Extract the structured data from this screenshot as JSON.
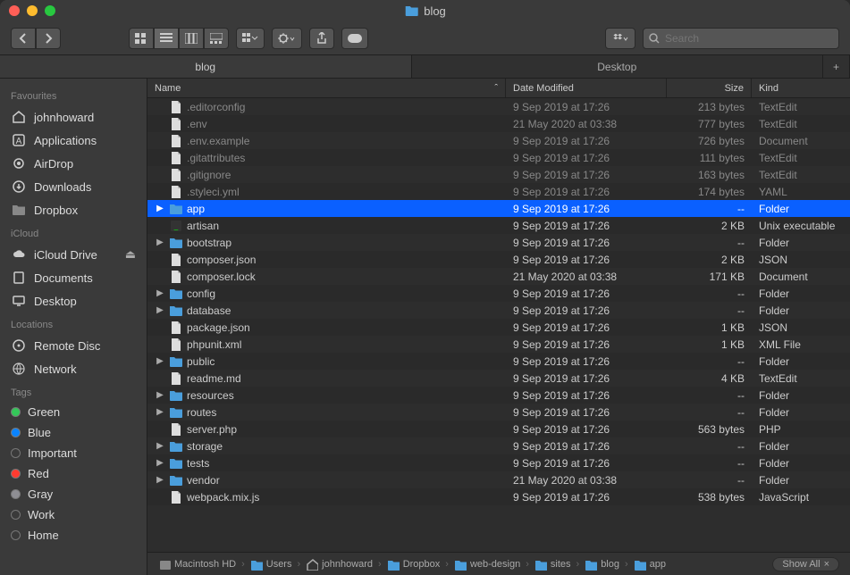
{
  "window": {
    "title": "blog"
  },
  "tabs": [
    {
      "label": "blog",
      "active": true
    },
    {
      "label": "Desktop",
      "active": false
    }
  ],
  "search": {
    "placeholder": "Search"
  },
  "sidebar": {
    "sections": [
      {
        "heading": "Favourites",
        "items": [
          {
            "icon": "home",
            "label": "johnhoward"
          },
          {
            "icon": "app",
            "label": "Applications"
          },
          {
            "icon": "airdrop",
            "label": "AirDrop"
          },
          {
            "icon": "downloads",
            "label": "Downloads"
          },
          {
            "icon": "folder",
            "label": "Dropbox"
          }
        ]
      },
      {
        "heading": "iCloud",
        "items": [
          {
            "icon": "cloud",
            "label": "iCloud Drive",
            "eject": true
          },
          {
            "icon": "doc",
            "label": "Documents"
          },
          {
            "icon": "desktop",
            "label": "Desktop"
          }
        ]
      },
      {
        "heading": "Locations",
        "items": [
          {
            "icon": "disc",
            "label": "Remote Disc"
          },
          {
            "icon": "globe",
            "label": "Network"
          }
        ]
      },
      {
        "heading": "Tags",
        "items": [
          {
            "icon": "tag",
            "color": "#34c759",
            "label": "Green"
          },
          {
            "icon": "tag",
            "color": "#0a84ff",
            "label": "Blue"
          },
          {
            "icon": "tag",
            "color": "",
            "label": "Important"
          },
          {
            "icon": "tag",
            "color": "#ff3b30",
            "label": "Red"
          },
          {
            "icon": "tag",
            "color": "#8e8e93",
            "label": "Gray"
          },
          {
            "icon": "tag",
            "color": "",
            "label": "Work"
          },
          {
            "icon": "tag",
            "color": "",
            "label": "Home"
          }
        ]
      }
    ]
  },
  "columns": {
    "name": "Name",
    "date": "Date Modified",
    "size": "Size",
    "kind": "Kind"
  },
  "files": [
    {
      "exp": "",
      "type": "file",
      "name": ".editorconfig",
      "date": "9 Sep 2019 at 17:26",
      "size": "213 bytes",
      "kind": "TextEdit",
      "dim": true
    },
    {
      "exp": "",
      "type": "file",
      "name": ".env",
      "date": "21 May 2020 at 03:38",
      "size": "777 bytes",
      "kind": "TextEdit",
      "dim": true
    },
    {
      "exp": "",
      "type": "file",
      "name": ".env.example",
      "date": "9 Sep 2019 at 17:26",
      "size": "726 bytes",
      "kind": "Document",
      "dim": true
    },
    {
      "exp": "",
      "type": "file",
      "name": ".gitattributes",
      "date": "9 Sep 2019 at 17:26",
      "size": "111 bytes",
      "kind": "TextEdit",
      "dim": true
    },
    {
      "exp": "",
      "type": "file",
      "name": ".gitignore",
      "date": "9 Sep 2019 at 17:26",
      "size": "163 bytes",
      "kind": "TextEdit",
      "dim": true
    },
    {
      "exp": "",
      "type": "file",
      "name": ".styleci.yml",
      "date": "9 Sep 2019 at 17:26",
      "size": "174 bytes",
      "kind": "YAML",
      "dim": true
    },
    {
      "exp": "▶",
      "type": "folder",
      "name": "app",
      "date": "9 Sep 2019 at 17:26",
      "size": "--",
      "kind": "Folder",
      "selected": true
    },
    {
      "exp": "",
      "type": "exec",
      "name": "artisan",
      "date": "9 Sep 2019 at 17:26",
      "size": "2 KB",
      "kind": "Unix executable"
    },
    {
      "exp": "▶",
      "type": "folder",
      "name": "bootstrap",
      "date": "9 Sep 2019 at 17:26",
      "size": "--",
      "kind": "Folder"
    },
    {
      "exp": "",
      "type": "file",
      "name": "composer.json",
      "date": "9 Sep 2019 at 17:26",
      "size": "2 KB",
      "kind": "JSON"
    },
    {
      "exp": "",
      "type": "file",
      "name": "composer.lock",
      "date": "21 May 2020 at 03:38",
      "size": "171 KB",
      "kind": "Document"
    },
    {
      "exp": "▶",
      "type": "folder",
      "name": "config",
      "date": "9 Sep 2019 at 17:26",
      "size": "--",
      "kind": "Folder"
    },
    {
      "exp": "▶",
      "type": "folder",
      "name": "database",
      "date": "9 Sep 2019 at 17:26",
      "size": "--",
      "kind": "Folder"
    },
    {
      "exp": "",
      "type": "file",
      "name": "package.json",
      "date": "9 Sep 2019 at 17:26",
      "size": "1 KB",
      "kind": "JSON"
    },
    {
      "exp": "",
      "type": "file",
      "name": "phpunit.xml",
      "date": "9 Sep 2019 at 17:26",
      "size": "1 KB",
      "kind": "XML File"
    },
    {
      "exp": "▶",
      "type": "folder",
      "name": "public",
      "date": "9 Sep 2019 at 17:26",
      "size": "--",
      "kind": "Folder"
    },
    {
      "exp": "",
      "type": "file",
      "name": "readme.md",
      "date": "9 Sep 2019 at 17:26",
      "size": "4 KB",
      "kind": "TextEdit"
    },
    {
      "exp": "▶",
      "type": "folder",
      "name": "resources",
      "date": "9 Sep 2019 at 17:26",
      "size": "--",
      "kind": "Folder"
    },
    {
      "exp": "▶",
      "type": "folder",
      "name": "routes",
      "date": "9 Sep 2019 at 17:26",
      "size": "--",
      "kind": "Folder"
    },
    {
      "exp": "",
      "type": "file",
      "name": "server.php",
      "date": "9 Sep 2019 at 17:26",
      "size": "563 bytes",
      "kind": "PHP"
    },
    {
      "exp": "▶",
      "type": "folder",
      "name": "storage",
      "date": "9 Sep 2019 at 17:26",
      "size": "--",
      "kind": "Folder"
    },
    {
      "exp": "▶",
      "type": "folder",
      "name": "tests",
      "date": "9 Sep 2019 at 17:26",
      "size": "--",
      "kind": "Folder"
    },
    {
      "exp": "▶",
      "type": "folder",
      "name": "vendor",
      "date": "21 May 2020 at 03:38",
      "size": "--",
      "kind": "Folder"
    },
    {
      "exp": "",
      "type": "file",
      "name": "webpack.mix.js",
      "date": "9 Sep 2019 at 17:26",
      "size": "538 bytes",
      "kind": "JavaScript"
    }
  ],
  "path": [
    {
      "icon": "disk",
      "label": "Macintosh HD"
    },
    {
      "icon": "folder",
      "label": "Users"
    },
    {
      "icon": "home",
      "label": "johnhoward"
    },
    {
      "icon": "folder",
      "label": "Dropbox"
    },
    {
      "icon": "folder",
      "label": "web-design"
    },
    {
      "icon": "folder",
      "label": "sites"
    },
    {
      "icon": "folder",
      "label": "blog"
    },
    {
      "icon": "folder",
      "label": "app"
    }
  ],
  "showall": "Show All"
}
